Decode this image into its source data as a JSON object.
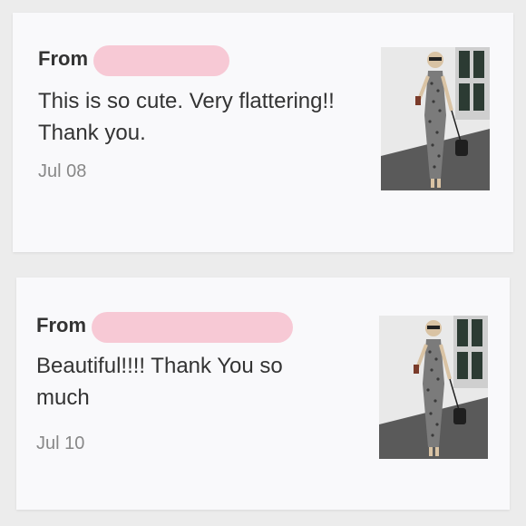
{
  "reviews": [
    {
      "from_label": "From",
      "message": "This is so cute. Very flattering!! Thank you.",
      "date": "Jul 08",
      "thumbnail_icon": "dress-photo"
    },
    {
      "from_label": "From",
      "message": "Beautiful!!!! Thank You so much",
      "date": "Jul 10",
      "thumbnail_icon": "dress-photo"
    }
  ],
  "colors": {
    "redaction": "#f7c9d5",
    "text": "#333333",
    "date": "#888888",
    "card": "#f9f9fb"
  }
}
